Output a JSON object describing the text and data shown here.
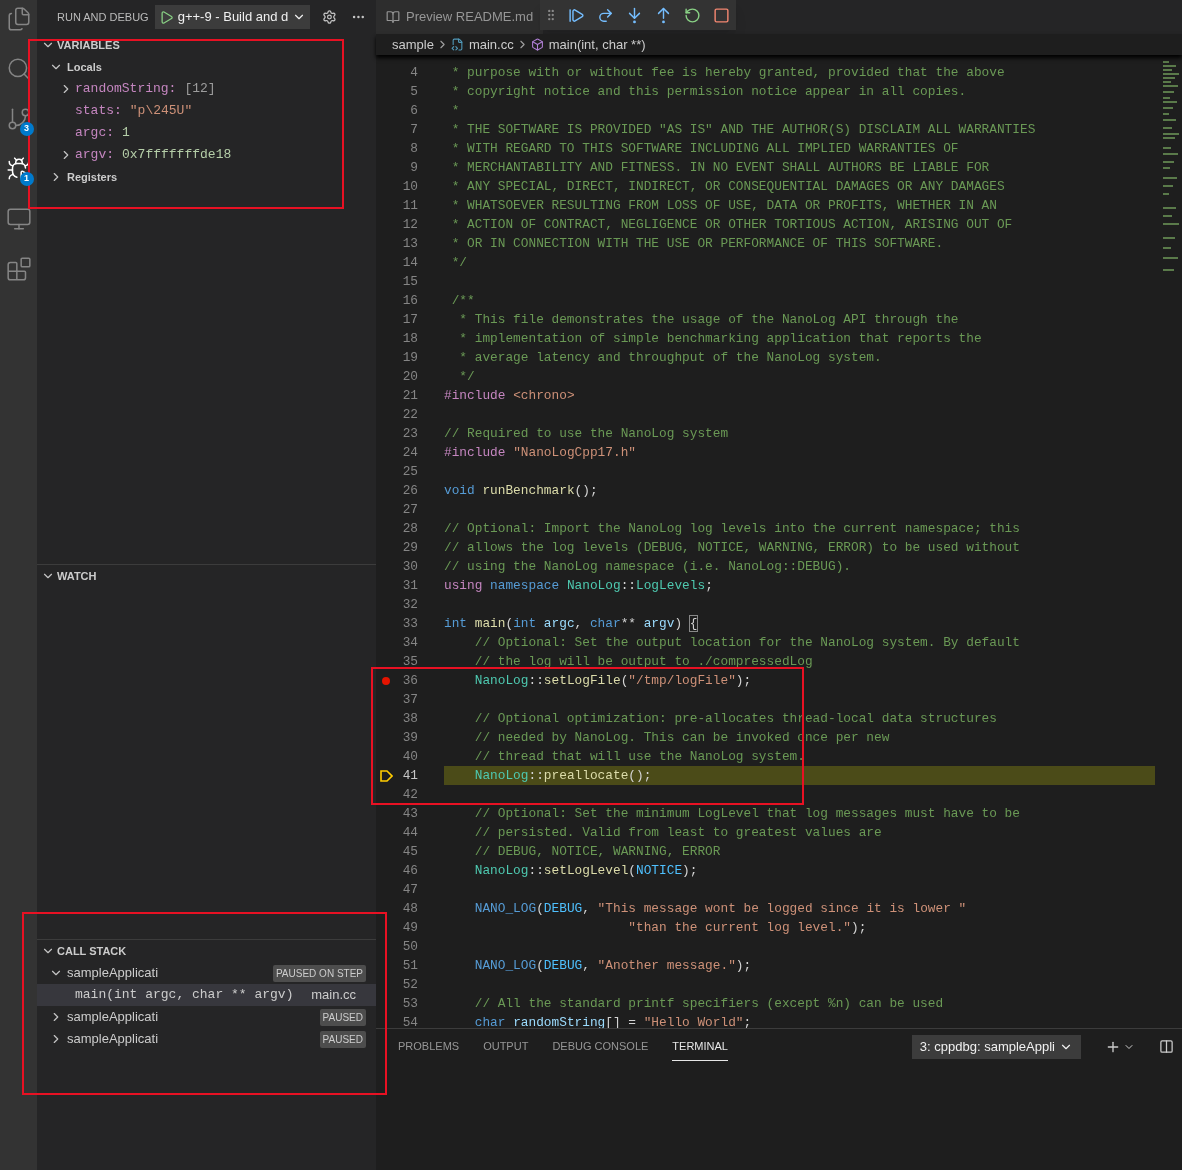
{
  "activity_bar": [
    {
      "kind": "explorer",
      "selected": false
    },
    {
      "kind": "search",
      "selected": false
    },
    {
      "kind": "source-control",
      "selected": false,
      "badge": "3"
    },
    {
      "kind": "debug",
      "selected": true,
      "badge": "1"
    },
    {
      "kind": "remote",
      "selected": false
    },
    {
      "kind": "extensions",
      "selected": false
    }
  ],
  "sidebar": {
    "title": "RUN AND DEBUG",
    "config": "g++-9 - Build and d",
    "variables": {
      "title": "VARIABLES",
      "expanded": true,
      "scopes": [
        {
          "label": "Locals",
          "expanded": true,
          "children": [
            {
              "kind": "collapsed",
              "name": "randomString:",
              "value": {
                "text": "[12]",
                "kind": "summary"
              }
            },
            {
              "kind": "leaf",
              "name": "stats:",
              "value": {
                "text": "\"p\\245U\"",
                "kind": "string"
              }
            },
            {
              "kind": "leaf",
              "name": "argc:",
              "value": {
                "text": "1",
                "kind": "number"
              }
            },
            {
              "kind": "collapsed",
              "name": "argv:",
              "value": {
                "text": "0x7fffffffde18",
                "kind": "number"
              }
            }
          ]
        },
        {
          "label": "Registers",
          "expanded": false
        }
      ]
    },
    "watch": {
      "title": "WATCH",
      "expanded": true
    },
    "call_stack": {
      "title": "CALL STACK",
      "expanded": true,
      "threads": [
        {
          "name": "sampleApplicati",
          "status": "PAUSED ON STEP",
          "expanded": true,
          "frames": [
            {
              "function": "main(int argc, char ** argv)",
              "file": "main.cc",
              "selected": true
            }
          ]
        },
        {
          "name": "sampleApplicati",
          "status": "PAUSED",
          "expanded": false
        },
        {
          "name": "sampleApplicati",
          "status": "PAUSED",
          "expanded": false
        }
      ]
    }
  },
  "editor": {
    "tabs": [
      {
        "label": "Preview README.md",
        "selected": false
      }
    ],
    "debug_toolbar": [
      {
        "kind": "continue"
      },
      {
        "kind": "step-over"
      },
      {
        "kind": "step-into"
      },
      {
        "kind": "step-out"
      },
      {
        "kind": "restart"
      },
      {
        "kind": "stop"
      }
    ],
    "breadcrumb": [
      {
        "kind": "folder",
        "label": "sample"
      },
      {
        "kind": "file",
        "label": "main.cc"
      },
      {
        "kind": "function",
        "label": "main(int, char **)"
      }
    ],
    "lines": [
      {
        "n": "4",
        "kind": "code",
        "tokens": [
          {
            "text": " * purpose with or without fee is hereby granted, provided that the above",
            "kind": "comment"
          }
        ]
      },
      {
        "n": "5",
        "kind": "code",
        "tokens": [
          {
            "text": " * copyright notice and this permission notice appear in all copies.",
            "kind": "comment"
          }
        ]
      },
      {
        "n": "6",
        "kind": "code",
        "tokens": [
          {
            "text": " *",
            "kind": "comment"
          }
        ]
      },
      {
        "n": "7",
        "kind": "code",
        "tokens": [
          {
            "text": " * THE SOFTWARE IS PROVIDED \"AS IS\" AND THE AUTHOR(S) DISCLAIM ALL WARRANTIES",
            "kind": "comment"
          }
        ]
      },
      {
        "n": "8",
        "kind": "code",
        "tokens": [
          {
            "text": " * WITH REGARD TO THIS SOFTWARE INCLUDING ALL IMPLIED WARRANTIES OF",
            "kind": "comment"
          }
        ]
      },
      {
        "n": "9",
        "kind": "code",
        "tokens": [
          {
            "text": " * MERCHANTABILITY AND FITNESS. IN NO EVENT SHALL AUTHORS BE LIABLE FOR",
            "kind": "comment"
          }
        ]
      },
      {
        "n": "10",
        "kind": "code",
        "tokens": [
          {
            "text": " * ANY SPECIAL, DIRECT, INDIRECT, OR CONSEQUENTIAL DAMAGES OR ANY DAMAGES",
            "kind": "comment"
          }
        ]
      },
      {
        "n": "11",
        "kind": "code",
        "tokens": [
          {
            "text": " * WHATSOEVER RESULTING FROM LOSS OF USE, DATA OR PROFITS, WHETHER IN AN",
            "kind": "comment"
          }
        ]
      },
      {
        "n": "12",
        "kind": "code",
        "tokens": [
          {
            "text": " * ACTION OF CONTRACT, NEGLIGENCE OR OTHER TORTIOUS ACTION, ARISING OUT OF",
            "kind": "comment"
          }
        ]
      },
      {
        "n": "13",
        "kind": "code",
        "tokens": [
          {
            "text": " * OR IN CONNECTION WITH THE USE OR PERFORMANCE OF THIS SOFTWARE.",
            "kind": "comment"
          }
        ]
      },
      {
        "n": "14",
        "kind": "code",
        "tokens": [
          {
            "text": " */",
            "kind": "comment"
          }
        ]
      },
      {
        "n": "15",
        "kind": "code"
      },
      {
        "n": "16",
        "kind": "code",
        "tokens": [
          {
            "text": " /**",
            "kind": "comment"
          }
        ]
      },
      {
        "n": "17",
        "kind": "code",
        "tokens": [
          {
            "text": "  * This file demonstrates the usage of the NanoLog API through the",
            "kind": "comment"
          }
        ]
      },
      {
        "n": "18",
        "kind": "code",
        "tokens": [
          {
            "text": "  * implementation of simple benchmarking application that reports the",
            "kind": "comment"
          }
        ]
      },
      {
        "n": "19",
        "kind": "code",
        "tokens": [
          {
            "text": "  * average latency and throughput of the NanoLog system.",
            "kind": "comment"
          }
        ]
      },
      {
        "n": "20",
        "kind": "code",
        "tokens": [
          {
            "text": "  */",
            "kind": "comment"
          }
        ]
      },
      {
        "n": "21",
        "kind": "code",
        "tokens": [
          {
            "text": "#include ",
            "kind": "preprocessor"
          },
          {
            "text": "<chrono>",
            "kind": "string"
          }
        ]
      },
      {
        "n": "22",
        "kind": "code"
      },
      {
        "n": "23",
        "kind": "code",
        "tokens": [
          {
            "text": "// Required to use the NanoLog system",
            "kind": "comment"
          }
        ]
      },
      {
        "n": "24",
        "kind": "code",
        "tokens": [
          {
            "text": "#include ",
            "kind": "preprocessor"
          },
          {
            "text": "\"NanoLogCpp17.h\"",
            "kind": "string"
          }
        ]
      },
      {
        "n": "25",
        "kind": "code"
      },
      {
        "n": "26",
        "kind": "code",
        "tokens": [
          {
            "text": "void ",
            "kind": "keyword"
          },
          {
            "text": "runBenchmark",
            "kind": "function"
          },
          {
            "text": "();",
            "kind": "plain"
          }
        ]
      },
      {
        "n": "27",
        "kind": "code"
      },
      {
        "n": "28",
        "kind": "code",
        "tokens": [
          {
            "text": "// Optional: Import the NanoLog log levels into the current namespace; this",
            "kind": "comment"
          }
        ]
      },
      {
        "n": "29",
        "kind": "code",
        "tokens": [
          {
            "text": "// allows the log levels (DEBUG, NOTICE, WARNING, ERROR) to be used without",
            "kind": "comment"
          }
        ]
      },
      {
        "n": "30",
        "kind": "code",
        "tokens": [
          {
            "text": "// using the NanoLog namespace (i.e. NanoLog::DEBUG).",
            "kind": "comment"
          }
        ]
      },
      {
        "n": "31",
        "kind": "code",
        "tokens": [
          {
            "text": "using ",
            "kind": "preprocessor"
          },
          {
            "text": "namespace ",
            "kind": "keyword"
          },
          {
            "text": "NanoLog",
            "kind": "type"
          },
          {
            "text": "::",
            "kind": "plain"
          },
          {
            "text": "LogLevels",
            "kind": "type"
          },
          {
            "text": ";",
            "kind": "plain"
          }
        ]
      },
      {
        "n": "32",
        "kind": "code"
      },
      {
        "n": "33",
        "kind": "code",
        "tokens": [
          {
            "text": "int ",
            "kind": "keyword"
          },
          {
            "text": "main",
            "kind": "function"
          },
          {
            "text": "(",
            "kind": "plain"
          },
          {
            "text": "int ",
            "kind": "keyword"
          },
          {
            "text": "argc",
            "kind": "variable"
          },
          {
            "text": ", ",
            "kind": "plain"
          },
          {
            "text": "char",
            "kind": "keyword"
          },
          {
            "text": "** ",
            "kind": "plain"
          },
          {
            "text": "argv",
            "kind": "variable"
          },
          {
            "text": ") ",
            "kind": "plain"
          },
          {
            "text": "{",
            "kind": "bracket"
          }
        ]
      },
      {
        "n": "34",
        "kind": "code",
        "tokens": [
          {
            "text": "    // Optional: Set the output location for the NanoLog system. By default",
            "kind": "comment"
          }
        ]
      },
      {
        "n": "35",
        "kind": "code",
        "tokens": [
          {
            "text": "    // the log will be output to ./compressedLog",
            "kind": "comment"
          }
        ]
      },
      {
        "n": "36",
        "kind": "breakpoint",
        "tokens": [
          {
            "text": "    NanoLog",
            "kind": "type"
          },
          {
            "text": "::",
            "kind": "plain"
          },
          {
            "text": "setLogFile",
            "kind": "function"
          },
          {
            "text": "(",
            "kind": "plain"
          },
          {
            "text": "\"/tmp/logFile\"",
            "kind": "string"
          },
          {
            "text": ");",
            "kind": "plain"
          }
        ]
      },
      {
        "n": "37",
        "kind": "code"
      },
      {
        "n": "38",
        "kind": "code",
        "tokens": [
          {
            "text": "    // Optional optimization: pre-allocates thread-local data structures",
            "kind": "comment"
          }
        ]
      },
      {
        "n": "39",
        "kind": "code",
        "tokens": [
          {
            "text": "    // needed by NanoLog. This can be invoked once per new",
            "kind": "comment"
          }
        ]
      },
      {
        "n": "40",
        "kind": "code",
        "tokens": [
          {
            "text": "    // thread that will use the NanoLog system.",
            "kind": "comment"
          }
        ]
      },
      {
        "n": "41",
        "kind": "current",
        "tokens": [
          {
            "text": "    NanoLog",
            "kind": "type"
          },
          {
            "text": "::",
            "kind": "plain"
          },
          {
            "text": "preallocate",
            "kind": "function"
          },
          {
            "text": "();",
            "kind": "plain"
          }
        ]
      },
      {
        "n": "42",
        "kind": "code"
      },
      {
        "n": "43",
        "kind": "code",
        "tokens": [
          {
            "text": "    // Optional: Set the minimum LogLevel that log messages must have to be",
            "kind": "comment"
          }
        ]
      },
      {
        "n": "44",
        "kind": "code",
        "tokens": [
          {
            "text": "    // persisted. Valid from least to greatest values are",
            "kind": "comment"
          }
        ]
      },
      {
        "n": "45",
        "kind": "code",
        "tokens": [
          {
            "text": "    // DEBUG, NOTICE, WARNING, ERROR",
            "kind": "comment"
          }
        ]
      },
      {
        "n": "46",
        "kind": "code",
        "tokens": [
          {
            "text": "    NanoLog",
            "kind": "type"
          },
          {
            "text": "::",
            "kind": "plain"
          },
          {
            "text": "setLogLevel",
            "kind": "function"
          },
          {
            "text": "(",
            "kind": "plain"
          },
          {
            "text": "NOTICE",
            "kind": "constant"
          },
          {
            "text": ");",
            "kind": "plain"
          }
        ]
      },
      {
        "n": "47",
        "kind": "code"
      },
      {
        "n": "48",
        "kind": "code",
        "tokens": [
          {
            "text": "    NANO_LOG",
            "kind": "macro"
          },
          {
            "text": "(",
            "kind": "plain"
          },
          {
            "text": "DEBUG",
            "kind": "constant"
          },
          {
            "text": ", ",
            "kind": "plain"
          },
          {
            "text": "\"This message wont be logged since it is lower \"",
            "kind": "string"
          }
        ]
      },
      {
        "n": "49",
        "kind": "code",
        "tokens": [
          {
            "text": "                        \"than the current log level.\"",
            "kind": "string"
          },
          {
            "text": ");",
            "kind": "plain"
          }
        ]
      },
      {
        "n": "50",
        "kind": "code"
      },
      {
        "n": "51",
        "kind": "code",
        "tokens": [
          {
            "text": "    NANO_LOG",
            "kind": "macro"
          },
          {
            "text": "(",
            "kind": "plain"
          },
          {
            "text": "DEBUG",
            "kind": "constant"
          },
          {
            "text": ", ",
            "kind": "plain"
          },
          {
            "text": "\"Another message.\"",
            "kind": "string"
          },
          {
            "text": ");",
            "kind": "plain"
          }
        ]
      },
      {
        "n": "52",
        "kind": "code"
      },
      {
        "n": "53",
        "kind": "code",
        "tokens": [
          {
            "text": "    // All the standard printf specifiers (except %n) can be used",
            "kind": "comment"
          }
        ]
      },
      {
        "n": "54",
        "kind": "code",
        "tokens": [
          {
            "text": "    char ",
            "kind": "keyword"
          },
          {
            "text": "randomString",
            "kind": "variable"
          },
          {
            "text": "[] = ",
            "kind": "plain"
          },
          {
            "text": "\"Hello World\"",
            "kind": "string"
          },
          {
            "text": ";",
            "kind": "plain"
          }
        ]
      }
    ]
  },
  "panel": {
    "tabs": [
      {
        "label": "PROBLEMS",
        "selected": false
      },
      {
        "label": "OUTPUT",
        "selected": false
      },
      {
        "label": "DEBUG CONSOLE",
        "selected": false
      },
      {
        "label": "TERMINAL",
        "selected": true
      }
    ],
    "terminal_select": "3: cppdbg: sampleAppli"
  }
}
